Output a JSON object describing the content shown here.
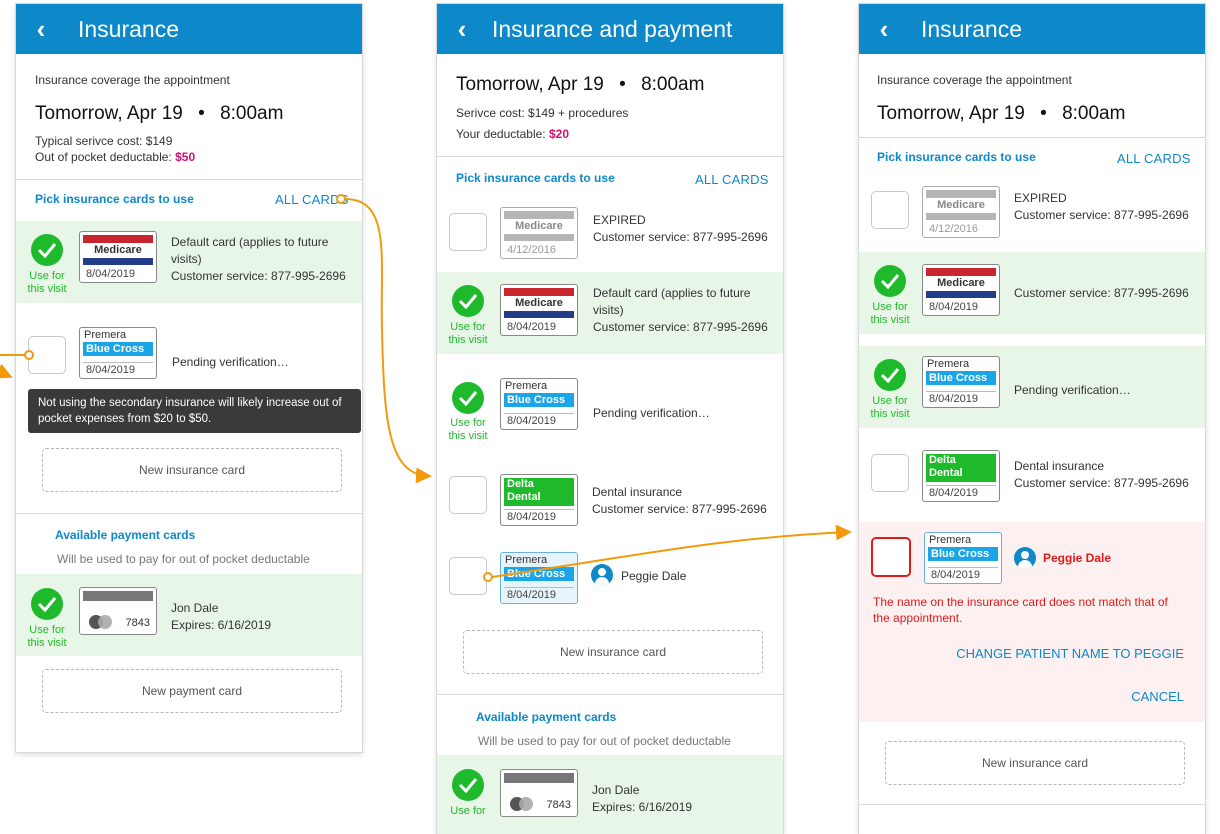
{
  "screen1": {
    "title": "Insurance",
    "coverage_label": "Insurance coverage the appointment",
    "date": "Tomorrow, Apr 19",
    "dot": "•",
    "time": "8:00am",
    "typical_cost": "Typical serivce cost: $149",
    "deductible_label": "Out of pocket deductable: ",
    "deductible_value": "$50",
    "pick_label": "Pick insurance cards to use",
    "all_cards": "ALL CARDS",
    "card1": {
      "name": "Medicare",
      "date": "8/04/2019",
      "line1": "Default card (applies to future",
      "line2": "visits)",
      "line3": "Customer service: 877-995-2696",
      "use1": "Use for",
      "use2": "this visit"
    },
    "card2": {
      "provider": "Premera",
      "name": "Blue Cross",
      "date": "8/04/2019",
      "status": "Pending verification…"
    },
    "tooltip": "Not using the secondary insurance will likely increase out of pocket expenses from $20 to $50.",
    "new_insurance": "New insurance card",
    "payment_header": "Available payment cards",
    "payment_sub": "Will be used to pay for out of pocket deductable",
    "pay": {
      "number": "7843",
      "holder": "Jon Dale",
      "expires": "Expires: 6/16/2019",
      "use1": "Use for",
      "use2": "this visit"
    },
    "new_payment": "New payment card"
  },
  "screen2": {
    "title": "Insurance and payment",
    "date": "Tomorrow, Apr 19",
    "dot": "•",
    "time": "8:00am",
    "service_cost": "Serivce cost: $149 + procedures",
    "deductible_label": "Your deductable: ",
    "deductible_value": "$20",
    "pick_label": "Pick insurance cards to use",
    "all_cards": "ALL CARDS",
    "card_expired": {
      "name": "Medicare",
      "date": "4/12/2016",
      "line1": "EXPIRED",
      "line2": "Customer service: 877-995-2696"
    },
    "card_default": {
      "name": "Medicare",
      "date": "8/04/2019",
      "line1": "Default card (applies to future",
      "line2": "visits)",
      "line3": "Customer service: 877-995-2696",
      "use1": "Use for",
      "use2": "this visit"
    },
    "card_pending": {
      "provider": "Premera",
      "name": "Blue Cross",
      "date": "8/04/2019",
      "status": "Pending verification…",
      "use1": "Use for",
      "use2": "this visit"
    },
    "card_dental": {
      "name1": "Delta",
      "name2": "Dental",
      "date": "8/04/2019",
      "line1": "Dental insurance",
      "line2": "Customer service: 877-995-2696"
    },
    "card_peggie": {
      "provider": "Premera",
      "name": "Blue Cross",
      "date": "8/04/2019",
      "person": "Peggie Dale"
    },
    "new_insurance": "New insurance card",
    "payment_header": "Available payment cards",
    "payment_sub": "Will be used to pay for out of pocket deductable",
    "pay": {
      "number": "7843",
      "holder": "Jon Dale",
      "expires": "Expires: 6/16/2019",
      "use1": "Use for"
    }
  },
  "screen3": {
    "title": "Insurance",
    "coverage_label": "Insurance coverage the appointment",
    "date": "Tomorrow, Apr 19",
    "dot": "•",
    "time": "8:00am",
    "pick_label": "Pick insurance cards to use",
    "all_cards": "ALL CARDS",
    "card_expired": {
      "name": "Medicare",
      "date": "4/12/2016",
      "line1": "EXPIRED",
      "line2": "Customer service: 877-995-2696"
    },
    "card_medicare": {
      "name": "Medicare",
      "date": "8/04/2019",
      "line1": "Customer service: 877-995-2696",
      "use1": "Use for",
      "use2": "this visit"
    },
    "card_pending": {
      "provider": "Premera",
      "name": "Blue Cross",
      "date": "8/04/2019",
      "status": "Pending verification…",
      "use1": "Use for",
      "use2": "this visit"
    },
    "card_dental": {
      "name1": "Delta",
      "name2": "Dental",
      "date": "8/04/2019",
      "line1": "Dental insurance",
      "line2": "Customer service: 877-995-2696"
    },
    "card_peggie": {
      "provider": "Premera",
      "name": "Blue Cross",
      "date": "8/04/2019",
      "person": "Peggie Dale"
    },
    "error_line1": "The name on the insurance card does not match that of",
    "error_line2": "the appointment.",
    "change_name": "CHANGE PATIENT NAME TO PEGGIE",
    "cancel": "CANCEL",
    "new_insurance": "New insurance card"
  },
  "colors": {
    "appbar": "#0d88c9",
    "green": "#1fba2c",
    "magenta": "#d0106e",
    "error": "#e01b1b",
    "arrow": "#f29a0c"
  }
}
